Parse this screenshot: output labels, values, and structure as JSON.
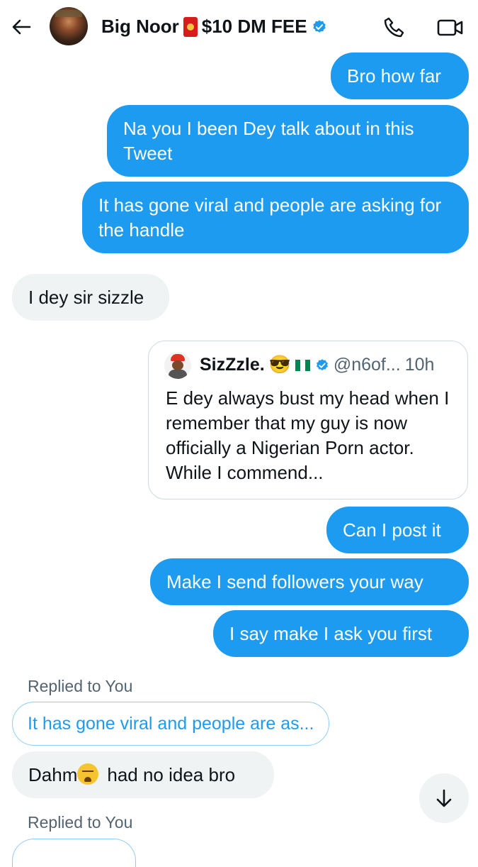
{
  "header": {
    "name": "Big Noor",
    "dm_fee": "$10 DM FEE",
    "back_icon": "arrow-left-icon",
    "call_icon": "phone-icon",
    "video_icon": "video-camera-icon"
  },
  "messages": [
    {
      "side": "out",
      "text": "Bro how far"
    },
    {
      "side": "out",
      "text": "Na you I been Dey talk about in this Tweet"
    },
    {
      "side": "out",
      "text": "It has gone viral and people are asking for the handle"
    },
    {
      "side": "in",
      "text": "I dey sir sizzle"
    },
    {
      "side": "out",
      "text": "Can I post it"
    },
    {
      "side": "out",
      "text": "Make I send followers your way"
    },
    {
      "side": "out",
      "text": "I say make I ask you first"
    },
    {
      "side": "in",
      "text": "had no idea bro",
      "prefix": "Dahm"
    }
  ],
  "quoted_tweet": {
    "name": "SizZzle.",
    "emoji": "😎",
    "handle": "@n6of...",
    "time": "10h",
    "text": "E dey always bust my head when I remember that my guy is now officially a Nigerian Porn actor. While I commend..."
  },
  "replies": [
    {
      "label": "Replied to You",
      "ref": "It has gone viral and people are as..."
    },
    {
      "label": "Replied to You"
    }
  ],
  "colors": {
    "accent": "#1d9bf0",
    "incoming_bubble": "#eff3f4",
    "muted_text": "#536471"
  }
}
